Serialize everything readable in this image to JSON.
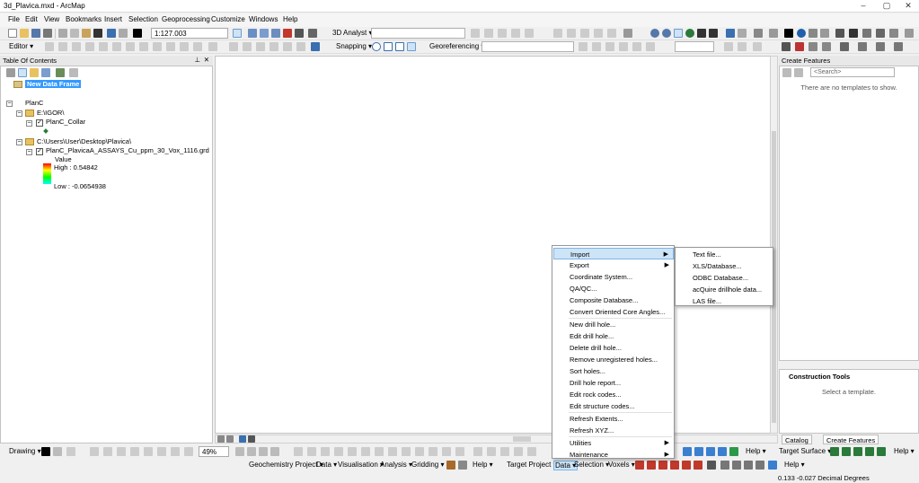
{
  "window": {
    "title": "3d_Plavica.mxd - ArcMap",
    "controls": [
      "–",
      "▢",
      "✕"
    ]
  },
  "menubar": [
    "File",
    "Edit",
    "View",
    "Bookmarks",
    "Insert",
    "Selection",
    "Geoprocessing",
    "Customize",
    "Windows",
    "Help"
  ],
  "toolbar1": {
    "scale": "1:127.003",
    "analyst_label": "3D Analyst ▾"
  },
  "toolbar2": {
    "editor_label": "Editor ▾",
    "snapping_label": "Snapping ▾",
    "georef_label": "Georeferencing ▾"
  },
  "toc": {
    "title": "Table Of Contents",
    "data_frame": "New Data Frame",
    "layers": {
      "group": "PlanC",
      "folder1": "E:\\IGOR\\",
      "layer1": "PlanC_Collar",
      "folder2": "C:\\Users\\User\\Desktop\\Plavica\\",
      "layer2": "PlanC_PlavicaA_ASSAYS_Cu_ppm_30_Vox_1116.grd",
      "value_label": "Value",
      "high_label": "High : 0.54842",
      "low_label": "Low : -0.0654938"
    }
  },
  "create_features": {
    "title": "Create Features",
    "search_placeholder": "<Search>",
    "empty_text": "There are no templates to show."
  },
  "construction_tools": {
    "title": "Construction Tools",
    "empty_text": "Select a template."
  },
  "tabs": {
    "catalog": "Catalog",
    "create_features": "Create Features"
  },
  "map_bottom": {
    "zoom": "49%"
  },
  "bottom_toolbar1": {
    "drawing_label": "Drawing ▾",
    "help1": "Help ▾",
    "target_surface": "Target Surface ▾",
    "help2": "Help ▾"
  },
  "bottom_toolbar2": {
    "items": [
      "Geochemistry Project ▾",
      "Data ▾",
      "Visualisation ▾",
      "Analysis ▾",
      "Gridding ▾",
      "Help ▾",
      "Target Project ▾",
      "Data ▾",
      "Selection ▾",
      "Voxels ▾"
    ],
    "help3": "Help ▾"
  },
  "data_menu": {
    "items": [
      {
        "label": "Import",
        "submenu": true,
        "highlight": true
      },
      {
        "label": "Export",
        "submenu": true
      },
      {
        "label": "Coordinate System..."
      },
      {
        "label": "QA/QC..."
      },
      {
        "label": "Composite Database..."
      },
      {
        "label": "Convert Oriented Core Angles..."
      },
      {
        "label": "New drill hole..."
      },
      {
        "label": "Edit drill hole..."
      },
      {
        "label": "Delete drill hole..."
      },
      {
        "label": "Remove unregistered holes..."
      },
      {
        "label": "Sort holes..."
      },
      {
        "label": "Drill hole report..."
      },
      {
        "label": "Edit rock codes..."
      },
      {
        "label": "Edit structure codes..."
      },
      {
        "label": "Refresh Extents..."
      },
      {
        "label": "Refresh XYZ..."
      },
      {
        "label": "Utilities",
        "submenu": true
      },
      {
        "label": "Maintenance",
        "submenu": true
      }
    ]
  },
  "import_submenu": {
    "items": [
      "Text file...",
      "XLS/Database...",
      "ODBC Database...",
      "acQuire drillhole data...",
      "LAS file..."
    ]
  },
  "status": {
    "coords": "0.133  -0.027 Decimal Degrees"
  },
  "colors": {
    "menu_highlight": "#cde4f7",
    "legend_ramp": [
      "#ff0000",
      "#ffff00",
      "#00ff00",
      "#00ffff"
    ]
  }
}
